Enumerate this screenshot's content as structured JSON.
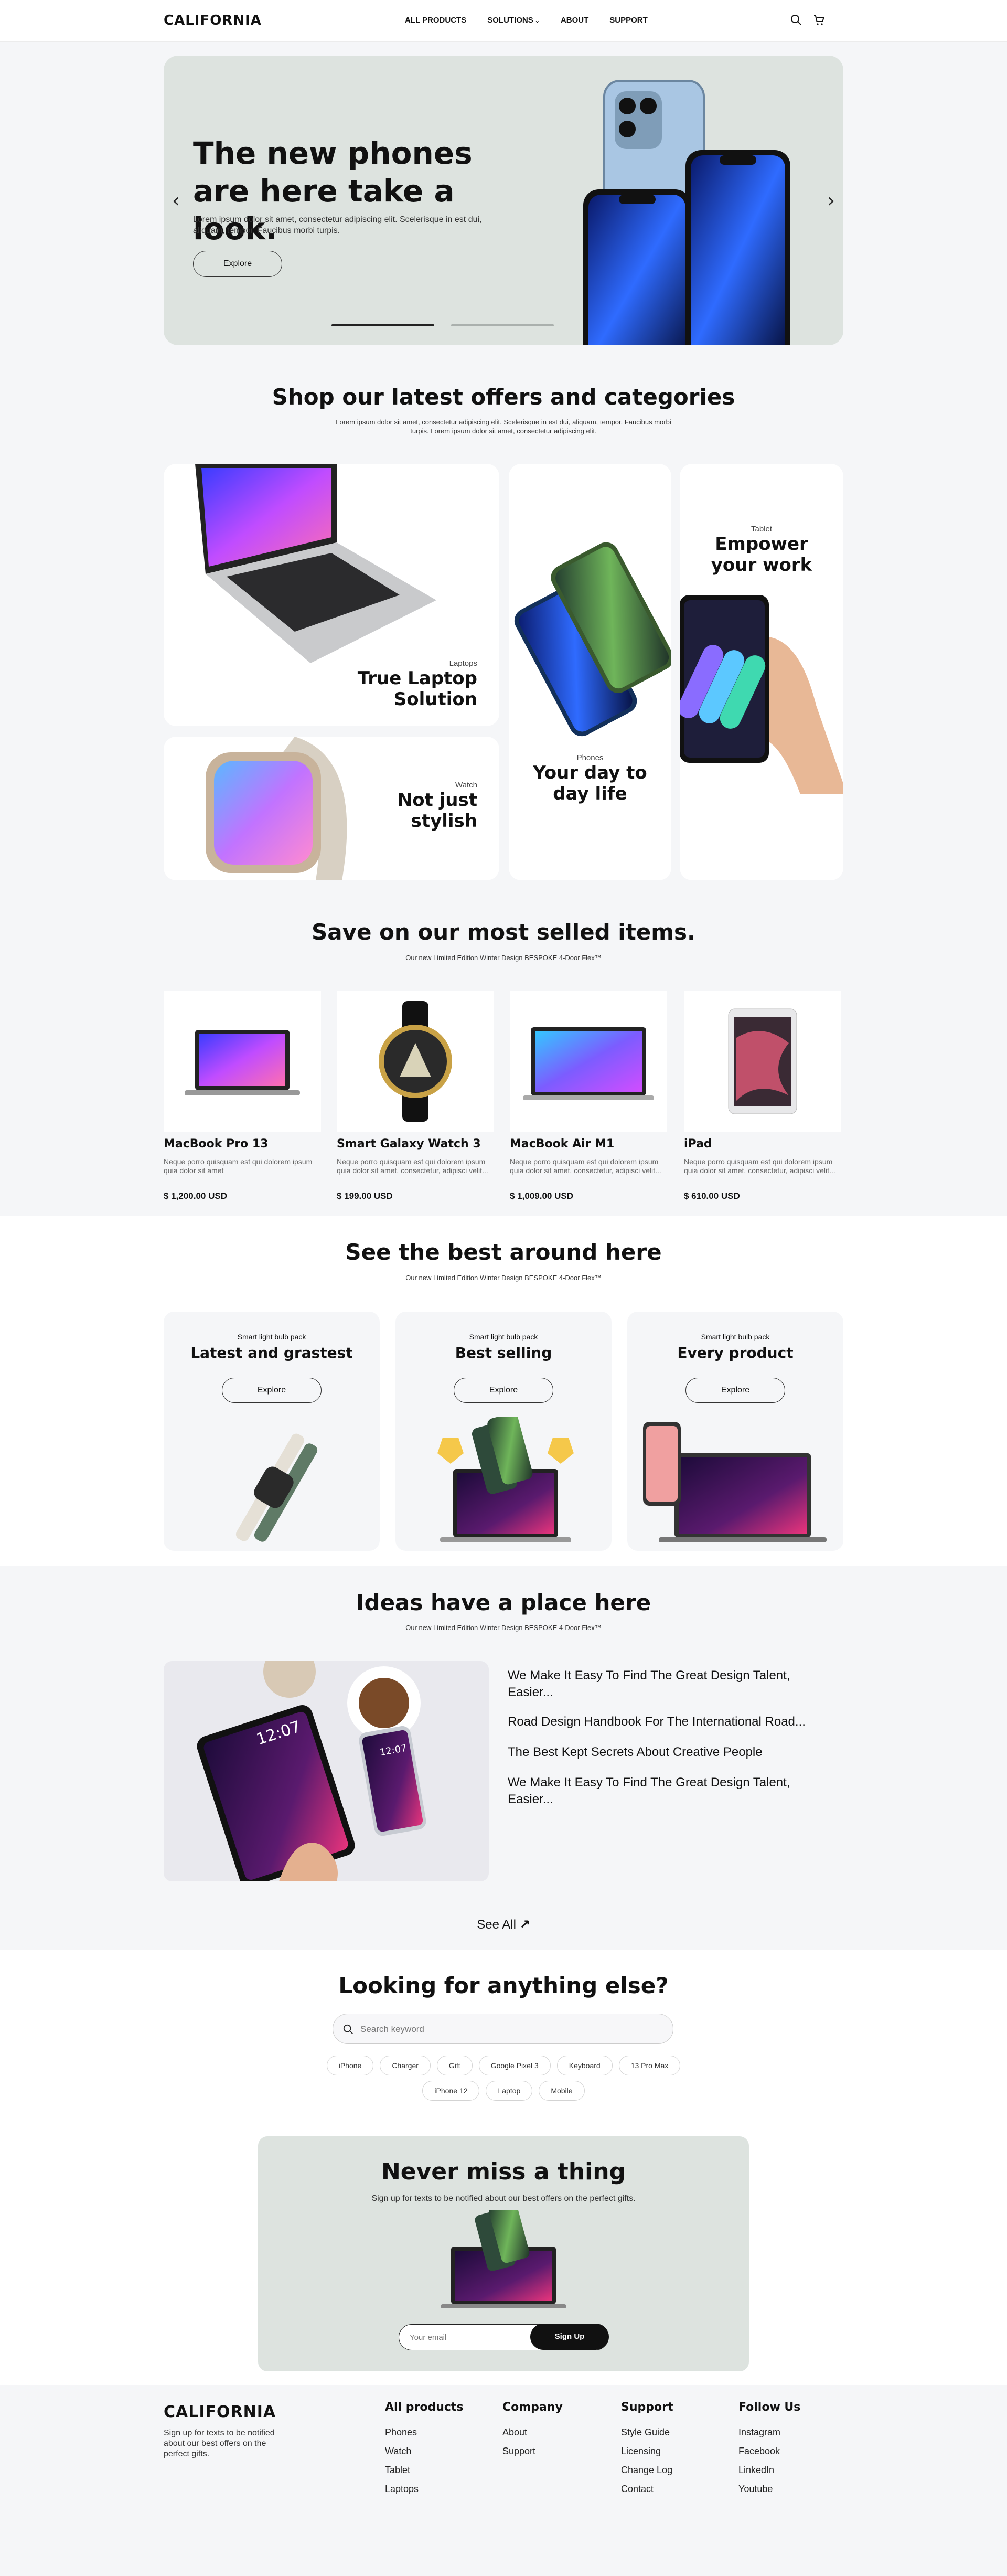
{
  "brand": "CALIFORNIA",
  "nav": {
    "items": [
      "ALL PRODUCTS",
      "SOLUTIONS",
      "ABOUT",
      "SUPPORT"
    ]
  },
  "hero": {
    "title": "The new phones are here take a look.",
    "description": "Lorem ipsum dolor sit amet, consectetur adipiscing elit. Scelerisque in est dui, aliquam, tempor. Faucibus morbi turpis.",
    "button": "Explore",
    "slide_count": 2,
    "active_slide": 1
  },
  "offers": {
    "title": "Shop our latest offers and categories",
    "subtitle": "Lorem ipsum dolor sit amet, consectetur adipiscing elit. Scelerisque in est dui, aliquam, tempor. Faucibus morbi turpis. Lorem ipsum dolor sit amet, consectetur adipiscing elit.",
    "categories": [
      {
        "small": "Laptops",
        "title": "True Laptop Solution"
      },
      {
        "small": "Watch",
        "title": "Not just stylish"
      },
      {
        "small": "Phones",
        "title": "Your day to day life"
      },
      {
        "small": "Tablet",
        "title": "Empower your work"
      }
    ]
  },
  "best_sellers": {
    "title": "Save on our most selled items.",
    "subtitle": "Our new Limited Edition Winter Design BESPOKE 4-Door Flex™",
    "products": [
      {
        "name": "MacBook Pro 13",
        "desc": "Neque porro quisquam est qui dolorem ipsum quia dolor sit amet",
        "price": "$ 1,200.00 USD"
      },
      {
        "name": "Smart Galaxy Watch 3",
        "desc": "Neque porro quisquam est qui dolorem ipsum quia dolor sit amet, consectetur, adipisci velit...",
        "price": "$ 199.00 USD"
      },
      {
        "name": "MacBook Air M1",
        "desc": "Neque porro quisquam est qui dolorem ipsum quia dolor sit amet, consectetur, adipisci velit...",
        "price": "$ 1,009.00 USD"
      },
      {
        "name": "iPad",
        "desc": "Neque porro quisquam est qui dolorem ipsum quia dolor sit amet, consectetur, adipisci velit...",
        "price": "$ 610.00 USD"
      }
    ]
  },
  "around": {
    "title": "See the best around here",
    "subtitle": "Our new Limited Edition Winter Design BESPOKE 4-Door Flex™",
    "cards": [
      {
        "small": "Smart light bulb pack",
        "title": "Latest and grastest",
        "button": "Explore"
      },
      {
        "small": "Smart light bulb pack",
        "title": "Best selling",
        "button": "Explore"
      },
      {
        "small": "Smart light bulb pack",
        "title": "Every product",
        "button": "Explore"
      }
    ]
  },
  "ideas": {
    "title": "Ideas have a place here",
    "subtitle": "Our new Limited Edition Winter Design BESPOKE 4-Door Flex™",
    "tablet_time": "12:07",
    "articles": [
      "We Make It Easy To Find The Great Design Talent, Easier...",
      "Road Design Handbook For The International Road...",
      "The Best Kept Secrets About Creative People",
      "We Make It Easy To Find The Great Design Talent, Easier..."
    ],
    "see_all": "See All"
  },
  "search": {
    "title": "Looking for anything else?",
    "placeholder": "Search keyword",
    "tags_row1": [
      "iPhone",
      "Charger",
      "Gift",
      "Google Pixel 3",
      "Keyboard",
      "13 Pro Max"
    ],
    "tags_row2": [
      "iPhone 12",
      "Laptop",
      "Mobile"
    ]
  },
  "newsletter": {
    "title": "Never miss a thing",
    "subtitle": "Sign up for texts to be notified about our best offers on  the perfect gifts.",
    "placeholder": "Your email",
    "button": "Sign Up"
  },
  "footer": {
    "brand": "CALIFORNIA",
    "tagline": "Sign up for texts to be notified about our best offers on  the perfect gifts.",
    "columns": [
      {
        "title": "All products",
        "links": [
          "Phones",
          "Watch",
          "Tablet",
          "Laptops"
        ]
      },
      {
        "title": "Company",
        "links": [
          "About",
          "Support"
        ]
      },
      {
        "title": "Support",
        "links": [
          "Style Guide",
          "Licensing",
          "Change Log",
          "Contact"
        ]
      },
      {
        "title": "Follow Us",
        "links": [
          "Instagram",
          "Facebook",
          "LinkedIn",
          "Youtube"
        ]
      }
    ]
  }
}
